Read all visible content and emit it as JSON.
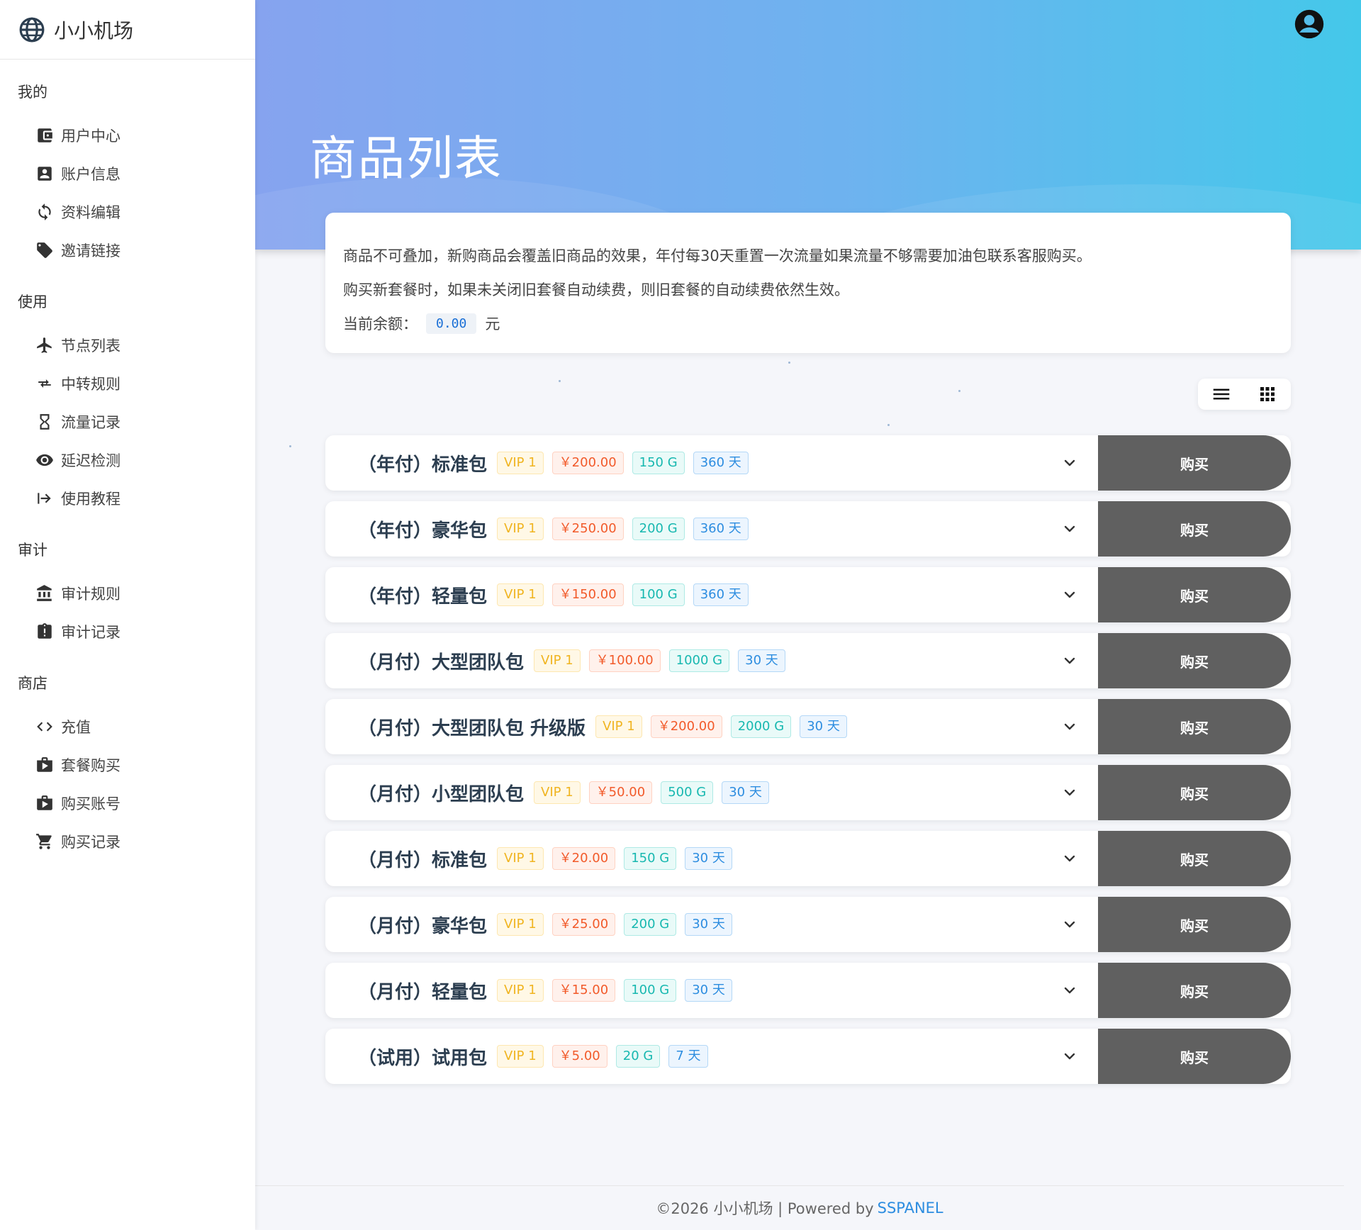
{
  "brand": {
    "name": "小小机场"
  },
  "sidebar": {
    "sections": [
      {
        "title": "我的",
        "items": [
          {
            "label": "用户中心",
            "icon": "wallet-icon"
          },
          {
            "label": "账户信息",
            "icon": "account-box-icon"
          },
          {
            "label": "资料编辑",
            "icon": "sync-icon"
          },
          {
            "label": "邀请链接",
            "icon": "tag-icon"
          }
        ]
      },
      {
        "title": "使用",
        "items": [
          {
            "label": "节点列表",
            "icon": "airplane-icon"
          },
          {
            "label": "中转规则",
            "icon": "transfer-icon"
          },
          {
            "label": "流量记录",
            "icon": "hourglass-icon"
          },
          {
            "label": "延迟检测",
            "icon": "eye-icon"
          },
          {
            "label": "使用教程",
            "icon": "arrow-right-bar-icon"
          }
        ]
      },
      {
        "title": "审计",
        "items": [
          {
            "label": "审计规则",
            "icon": "bank-icon"
          },
          {
            "label": "审计记录",
            "icon": "clipboard-alert-icon"
          }
        ]
      },
      {
        "title": "商店",
        "items": [
          {
            "label": "充值",
            "icon": "code-icon"
          },
          {
            "label": "套餐购买",
            "icon": "shop-bag-icon"
          },
          {
            "label": "购买账号",
            "icon": "shop-bag-icon"
          },
          {
            "label": "购买记录",
            "icon": "cart-icon"
          }
        ]
      }
    ]
  },
  "header": {
    "title": "商品列表"
  },
  "info": {
    "line1": "商品不可叠加，新购商品会覆盖旧商品的效果，年付每30天重置一次流量如果流量不够需要加油包联系客服购买。",
    "line2": "购买新套餐时，如果未关闭旧套餐自动续费，则旧套餐的自动续费依然生效。",
    "balance_label": "当前余额：",
    "balance_value": "0.00",
    "balance_unit": "元"
  },
  "buy_label": "购买",
  "products": [
    {
      "name": "（年付）标准包",
      "vip": "VIP 1",
      "price": "￥200.00",
      "traffic": "150 G",
      "days": "360 天"
    },
    {
      "name": "（年付）豪华包",
      "vip": "VIP 1",
      "price": "￥250.00",
      "traffic": "200 G",
      "days": "360 天"
    },
    {
      "name": "（年付）轻量包",
      "vip": "VIP 1",
      "price": "￥150.00",
      "traffic": "100 G",
      "days": "360 天"
    },
    {
      "name": "（月付）大型团队包",
      "vip": "VIP 1",
      "price": "￥100.00",
      "traffic": "1000 G",
      "days": "30 天"
    },
    {
      "name": "（月付）大型团队包 升级版",
      "vip": "VIP 1",
      "price": "￥200.00",
      "traffic": "2000 G",
      "days": "30 天"
    },
    {
      "name": "（月付）小型团队包",
      "vip": "VIP 1",
      "price": "￥50.00",
      "traffic": "500 G",
      "days": "30 天"
    },
    {
      "name": "（月付）标准包",
      "vip": "VIP 1",
      "price": "￥20.00",
      "traffic": "150 G",
      "days": "30 天"
    },
    {
      "name": "（月付）豪华包",
      "vip": "VIP 1",
      "price": "￥25.00",
      "traffic": "200 G",
      "days": "30 天"
    },
    {
      "name": "（月付）轻量包",
      "vip": "VIP 1",
      "price": "￥15.00",
      "traffic": "100 G",
      "days": "30 天"
    },
    {
      "name": "（试用）试用包",
      "vip": "VIP 1",
      "price": "￥5.00",
      "traffic": "20 G",
      "days": "7 天"
    }
  ],
  "footer": {
    "text": "©2026 小小机场 | Powered by",
    "link": "SSPANEL"
  },
  "colors": {
    "header_gradient_start": "#86a3ef",
    "header_gradient_end": "#44c8ea",
    "buy_button": "#606060",
    "vip": "#f0b420",
    "price": "#f25a2a",
    "traffic": "#17b8b0",
    "days": "#2d8de0",
    "link": "#2d8de0"
  }
}
